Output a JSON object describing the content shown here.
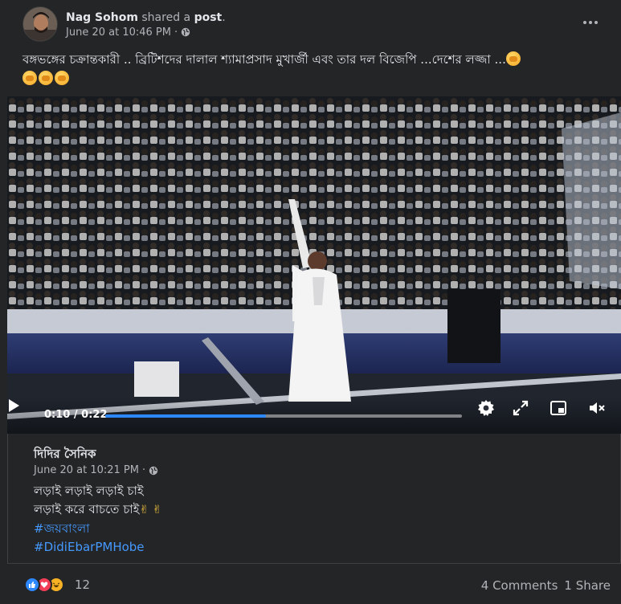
{
  "post": {
    "author": "Nag Sohom",
    "action_text": "shared a",
    "object_text": "post",
    "period": ".",
    "timestamp": "June 20 at 10:46 PM",
    "separator": "·",
    "text": "বঙ্গভঙ্গের চক্রান্তকারী .. ব্রিটিশদের দালাল শ্যামাপ্রসাদ মুখার্জী এবং তার দল বিজেপি ...দেশের লজ্জা ...",
    "privacy_icon": "globe-icon",
    "more_icon": "more-options-icon"
  },
  "video": {
    "current_time": "0:10",
    "duration": "0:22",
    "time_separator": " / ",
    "progress": 0.45,
    "icons": [
      "play-icon",
      "settings-gear-icon",
      "fullscreen-icon",
      "mini-player-icon",
      "volume-muted-icon"
    ]
  },
  "shared": {
    "name": "দিদির সৈনিক",
    "timestamp": "June 20 at 10:21 PM",
    "separator": "·",
    "line1": "লড়াই লড়াই লড়াই চাই",
    "line2": "লড়াই করে বাচতে চাই",
    "victory": "✌ ✌",
    "hashtag1": "#জয়বাংলা",
    "hashtag2": "#DidiEbarPMHobe"
  },
  "footer": {
    "reaction_count": "12",
    "comments": "4 Comments",
    "shares": "1 Share",
    "reactions": [
      "like",
      "love",
      "haha"
    ]
  },
  "colors": {
    "background": "#242526",
    "text_primary": "#e4e6eb",
    "text_secondary": "#b0b3b8",
    "link": "#4599ff",
    "progress_fill": "#2d88ff"
  }
}
